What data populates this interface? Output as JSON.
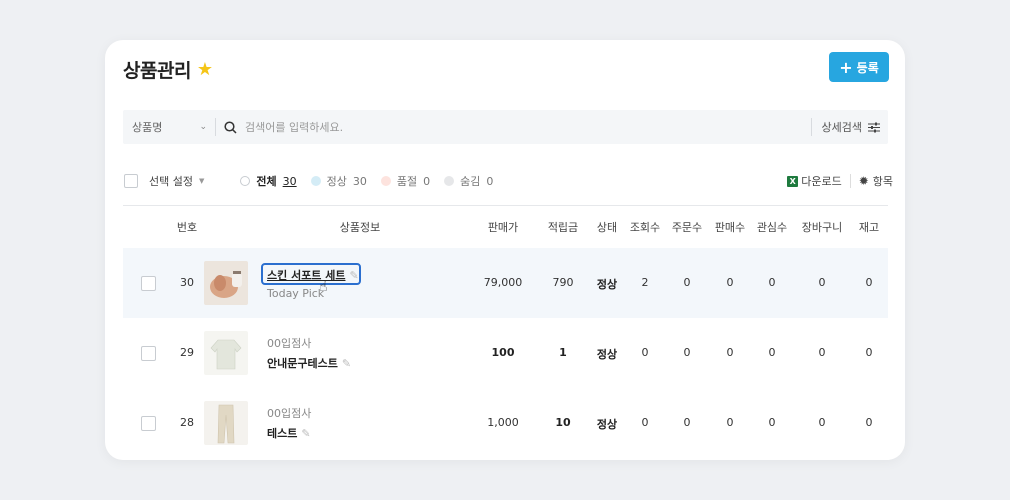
{
  "header": {
    "title": "상품관리",
    "add_label": "등록"
  },
  "search": {
    "field_label": "상품명",
    "placeholder": "검색어를 입력하세요.",
    "detail_label": "상세검색"
  },
  "filters": {
    "select_label": "선택 설정",
    "items": [
      {
        "label": "전체",
        "count": "30",
        "color": "#ffffff"
      },
      {
        "label": "정상",
        "count": "30",
        "color": "#d4ecf6"
      },
      {
        "label": "품절",
        "count": "0",
        "color": "#fde3de"
      },
      {
        "label": "숨김",
        "count": "0",
        "color": "#e6e7e9"
      }
    ],
    "download_label": "다운로드",
    "columns_label": "항목"
  },
  "table": {
    "headers": [
      "번호",
      "상품정보",
      "판매가",
      "적립금",
      "상태",
      "조회수",
      "주문수",
      "판매수",
      "관심수",
      "장바구니",
      "재고"
    ],
    "rows": [
      {
        "no": "30",
        "seller": "",
        "name": "스킨 서포트 세트",
        "sub": "Today Pick",
        "price": "79,000",
        "point": "790",
        "status": "정상",
        "views": "2",
        "orders": "0",
        "sales": "0",
        "likes": "0",
        "cart": "0",
        "stock": "0"
      },
      {
        "no": "29",
        "seller": "00입점사",
        "name": "안내문구테스트",
        "sub": "",
        "price": "100",
        "point": "1",
        "status": "정상",
        "views": "0",
        "orders": "0",
        "sales": "0",
        "likes": "0",
        "cart": "0",
        "stock": "0"
      },
      {
        "no": "28",
        "seller": "00입점사",
        "name": "테스트",
        "sub": "",
        "price": "1,000",
        "point": "10",
        "status": "정상",
        "views": "0",
        "orders": "0",
        "sales": "0",
        "likes": "0",
        "cart": "0",
        "stock": "0"
      }
    ]
  },
  "colors": {
    "accent": "#27a6e0",
    "focus": "#2b6fcf",
    "star": "#f5c518"
  }
}
